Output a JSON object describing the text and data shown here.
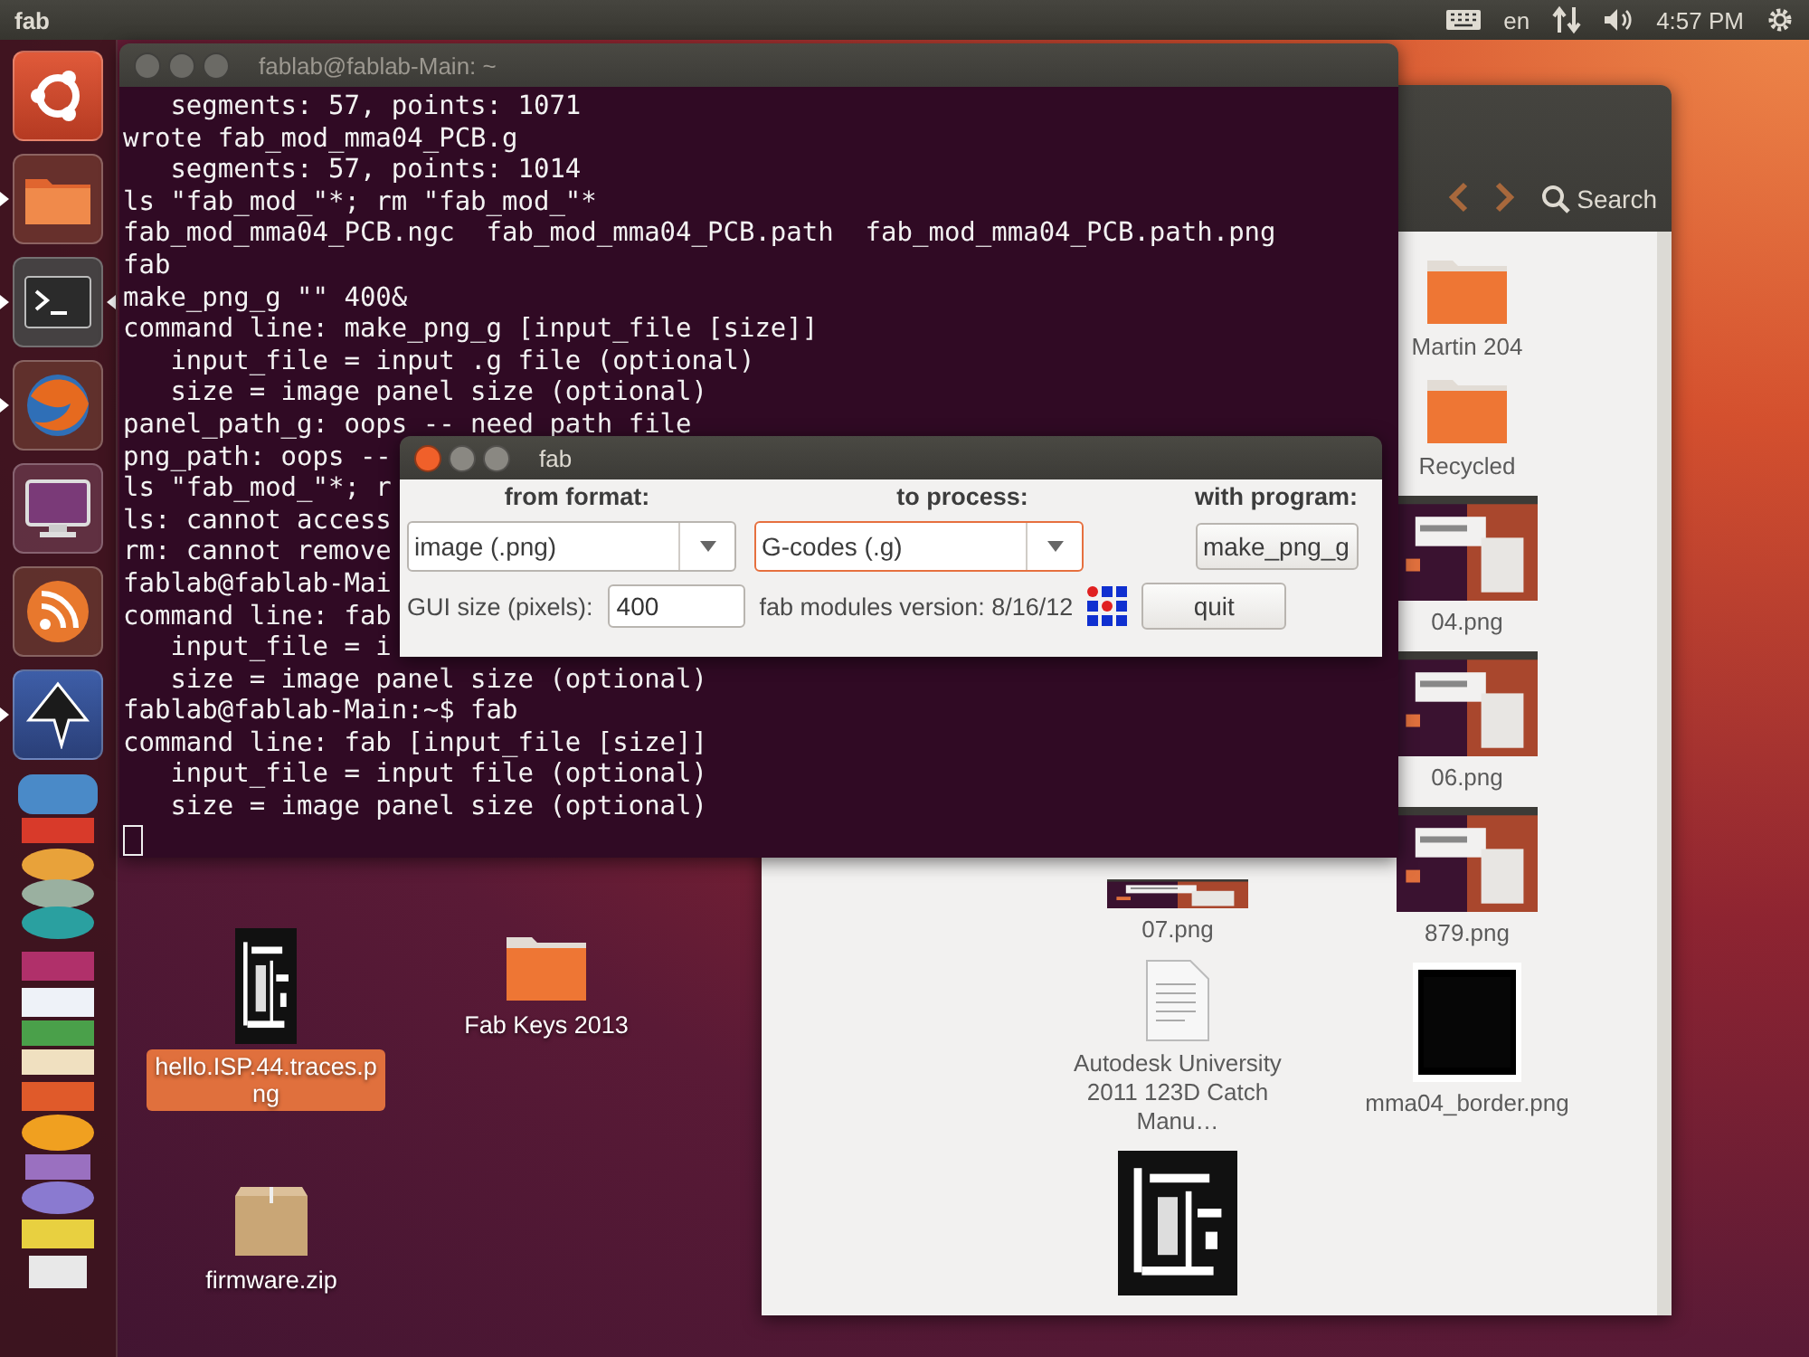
{
  "top_panel": {
    "app_name": "fab",
    "keyboard_layout": "en",
    "clock": "4:57 PM"
  },
  "launcher": {
    "items": [
      {
        "kind": "ubuntu",
        "running": false,
        "focused": false
      },
      {
        "kind": "files",
        "running": true,
        "focused": false
      },
      {
        "kind": "terminal",
        "running": true,
        "focused": true
      },
      {
        "kind": "browser",
        "running": true,
        "focused": false
      },
      {
        "kind": "monitor",
        "running": false,
        "focused": false
      },
      {
        "kind": "feed",
        "running": false,
        "focused": false
      },
      {
        "kind": "pen",
        "running": true,
        "focused": false
      }
    ]
  },
  "terminal": {
    "title": "fablab@fablab-Main: ~",
    "cursor": true,
    "lines": [
      "   segments: 57, points: 1071",
      "wrote fab_mod_mma04_PCB.g",
      "   segments: 57, points: 1014",
      "ls \"fab_mod_\"*; rm \"fab_mod_\"*",
      "fab_mod_mma04_PCB.ngc  fab_mod_mma04_PCB.path  fab_mod_mma04_PCB.path.png",
      "fab",
      "make_png_g \"\" 400&",
      "command line: make_png_g [input_file [size]]",
      "   input_file = input .g file (optional)",
      "   size = image panel size (optional)",
      "panel_path_g: oops -- need path file",
      "png_path: oops --",
      "ls \"fab_mod_\"*; r",
      "ls: cannot access",
      "rm: cannot remove",
      "fablab@fablab-Mai",
      "command line: fab",
      "   input_file = i",
      "   size = image panel size (optional)",
      "fablab@fablab-Main:~$ fab",
      "command line: fab [input_file [size]]",
      "   input_file = input file (optional)",
      "   size = image panel size (optional)"
    ]
  },
  "fab_dialog": {
    "title": "fab",
    "headings": [
      "from format:",
      "to process:",
      "with program:"
    ],
    "selects": [
      {
        "value": "image (.png)",
        "focused": false
      },
      {
        "value": "G-codes (.g)",
        "focused": true
      }
    ],
    "program_button": "make_png_g",
    "gui_size_label": "GUI size (pixels):",
    "gui_size_value": "400",
    "version": "fab modules version: 8/16/12",
    "quit_button": "quit"
  },
  "file_manager": {
    "search_label": "Search",
    "left_column": [
      {
        "label": "07.png",
        "kind": "screenshot-strip"
      },
      {
        "label": "Autodesk University 2011 123D Catch Manu…",
        "kind": "document"
      },
      {
        "kind": "pcb"
      }
    ],
    "right_column": [
      {
        "label": "Martin 204",
        "kind": "folder"
      },
      {
        "label": "Recycled",
        "kind": "folder"
      },
      {
        "label": "04.png",
        "kind": "screenshot"
      },
      {
        "label": "06.png",
        "kind": "screenshot"
      },
      {
        "label": "879.png",
        "kind": "screenshot"
      },
      {
        "label": "mma04_border.png",
        "kind": "black"
      }
    ]
  },
  "desktop_icons": [
    {
      "label": "hello.ISP.44.traces.png",
      "kind": "pcb",
      "selected": true
    },
    {
      "label": "Fab Keys 2013",
      "kind": "folder",
      "selected": false
    },
    {
      "label": "firmware.zip",
      "kind": "zip",
      "selected": false
    }
  ]
}
